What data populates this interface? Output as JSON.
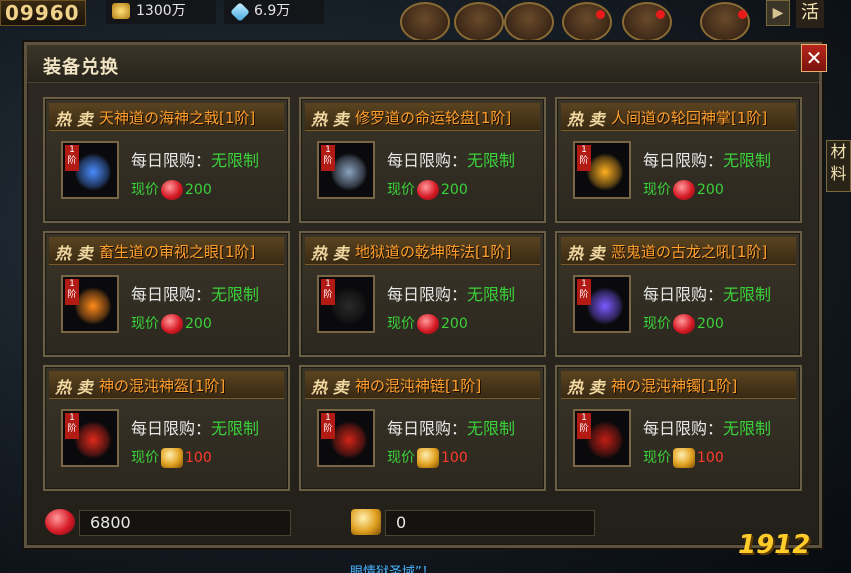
{
  "hud": {
    "score": "09960",
    "gold": "1300万",
    "diamond": "6.9万",
    "activity_label": "活"
  },
  "panel": {
    "title": "装备兑换",
    "close": "✕"
  },
  "items": [
    {
      "hot": "热 卖",
      "name": "天神道の海神之戟[1阶]",
      "tier": "1 阶",
      "limit_label": "每日限购：",
      "limit_value": "无限制",
      "price_label": "现价",
      "currency": "red",
      "price": "200",
      "art_color": "#4a8cff",
      "icon": "trident-icon"
    },
    {
      "hot": "热 卖",
      "name": "修罗道の命运轮盘[1阶]",
      "tier": "1 阶",
      "limit_label": "每日限购：",
      "limit_value": "无限制",
      "price_label": "现价",
      "currency": "red",
      "price": "200",
      "art_color": "#8aa2c0",
      "icon": "wheel-icon"
    },
    {
      "hot": "热 卖",
      "name": "人间道の轮回神掌[1阶]",
      "tier": "1 阶",
      "limit_label": "每日限购：",
      "limit_value": "无限制",
      "price_label": "现价",
      "currency": "red",
      "price": "200",
      "art_color": "#ffb020",
      "icon": "palm-icon"
    },
    {
      "hot": "热 卖",
      "name": "畜生道の审视之眼[1阶]",
      "tier": "1 阶",
      "limit_label": "每日限购：",
      "limit_value": "无限制",
      "price_label": "现价",
      "currency": "red",
      "price": "200",
      "art_color": "#ff8a1a",
      "icon": "eye-icon"
    },
    {
      "hot": "热 卖",
      "name": "地狱道の乾坤阵法[1阶]",
      "tier": "1 阶",
      "limit_label": "每日限购：",
      "limit_value": "无限制",
      "price_label": "现价",
      "currency": "red",
      "price": "200",
      "art_color": "#2a2a2a",
      "icon": "formation-icon"
    },
    {
      "hot": "热 卖",
      "name": "恶鬼道の古龙之吼[1阶]",
      "tier": "1 阶",
      "limit_label": "每日限购：",
      "limit_value": "无限制",
      "price_label": "现价",
      "currency": "red",
      "price": "200",
      "art_color": "#7a5aff",
      "icon": "dragon-icon"
    },
    {
      "hot": "热 卖",
      "name": "神の混沌神盔[1阶]",
      "tier": "1 阶",
      "limit_label": "每日限购：",
      "limit_value": "无限制",
      "price_label": "现价",
      "currency": "gold",
      "price": "100",
      "art_color": "#e0281c",
      "icon": "helmet-icon"
    },
    {
      "hot": "热 卖",
      "name": "神の混沌神链[1阶]",
      "tier": "1 阶",
      "limit_label": "每日限购：",
      "limit_value": "无限制",
      "price_label": "现价",
      "currency": "gold",
      "price": "100",
      "art_color": "#d02418",
      "icon": "necklace-icon"
    },
    {
      "hot": "热 卖",
      "name": "神の混沌神镯[1阶]",
      "tier": "1 阶",
      "limit_label": "每日限购：",
      "limit_value": "无限制",
      "price_label": "现价",
      "currency": "gold",
      "price": "100",
      "art_color": "#c01e14",
      "icon": "bracelet-icon"
    }
  ],
  "balances": {
    "red_gems": "6800",
    "gold_gems": "0"
  },
  "side": {
    "materials_tab": "材料"
  },
  "bottom_text": "眼情狱圣域”！",
  "logo": "1912"
}
